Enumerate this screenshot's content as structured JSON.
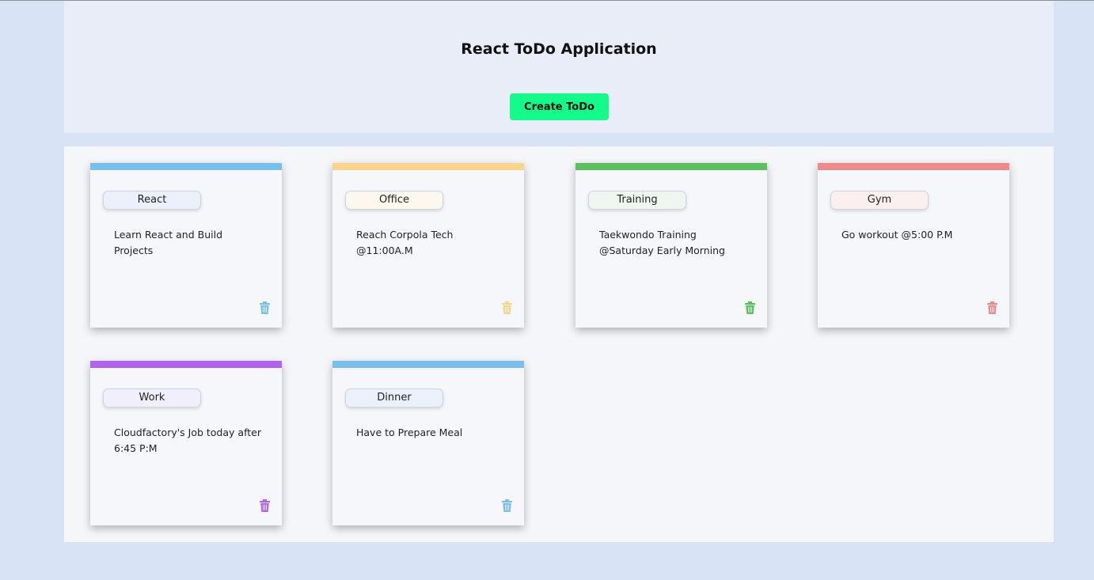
{
  "app": {
    "title": "React ToDo Application",
    "create_button_label": "Create ToDo"
  },
  "colors": {
    "page_background": "#d9e3f6",
    "header_background": "#e8edf7",
    "board_background": "#f4f6f9",
    "create_button": "#13fb8a"
  },
  "todos": [
    {
      "category": "React",
      "text": "Learn React and Build Projects",
      "accent": "#79bfee",
      "chip_bg": "#eaf1fb",
      "icon": "trash-icon"
    },
    {
      "category": "Office",
      "text": "Reach Corpola Tech @11:00A.M",
      "accent": "#f9d48a",
      "chip_bg": "#fdf8ee",
      "icon": "trash-icon"
    },
    {
      "category": "Training",
      "text": "Taekwondo Training @Saturday Early Morning",
      "accent": "#5ac05a",
      "chip_bg": "#eef7ef",
      "icon": "trash-icon"
    },
    {
      "category": "Gym",
      "text": "Go workout @5:00 P.M",
      "accent": "#ee8a8a",
      "chip_bg": "#fcefef",
      "icon": "trash-icon"
    },
    {
      "category": "Work",
      "text": "Cloudfactory's Job today after 6:45 P:M",
      "accent": "#b360ef",
      "chip_bg": "#f1effb",
      "icon": "trash-icon"
    },
    {
      "category": "Dinner",
      "text": "Have to Prepare Meal",
      "accent": "#79bfee",
      "chip_bg": "#eaf1fb",
      "icon": "trash-icon"
    }
  ]
}
